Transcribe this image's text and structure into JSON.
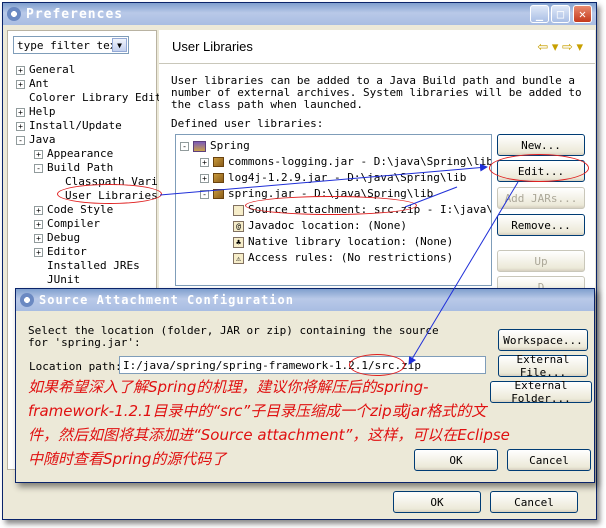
{
  "window": {
    "title": "Preferences"
  },
  "left": {
    "filter_text": "type filter tex",
    "tree": [
      {
        "label": "General",
        "toggle": "+",
        "indent": 0
      },
      {
        "label": "Ant",
        "toggle": "+",
        "indent": 0
      },
      {
        "label": "Colorer Library Edit",
        "toggle": "",
        "indent": 0
      },
      {
        "label": "Help",
        "toggle": "+",
        "indent": 0
      },
      {
        "label": "Install/Update",
        "toggle": "+",
        "indent": 0
      },
      {
        "label": "Java",
        "toggle": "-",
        "indent": 0
      },
      {
        "label": "Appearance",
        "toggle": "+",
        "indent": 1
      },
      {
        "label": "Build Path",
        "toggle": "-",
        "indent": 1
      },
      {
        "label": "Classpath Vari",
        "toggle": "",
        "indent": 2
      },
      {
        "label": "User Libraries",
        "toggle": "",
        "indent": 2
      },
      {
        "label": "Code Style",
        "toggle": "+",
        "indent": 1
      },
      {
        "label": "Compiler",
        "toggle": "+",
        "indent": 1
      },
      {
        "label": "Debug",
        "toggle": "+",
        "indent": 1
      },
      {
        "label": "Editor",
        "toggle": "+",
        "indent": 1
      },
      {
        "label": "Installed JREs",
        "toggle": "",
        "indent": 1
      },
      {
        "label": "JUnit",
        "toggle": "",
        "indent": 1
      }
    ]
  },
  "right": {
    "title": "User Libraries",
    "nav": "⇦ ▾ ⇨ ▾",
    "description": "User libraries can be added to a Java Build path and bundle a number of external archives. System libraries will be added to the class path when launched.",
    "defined_label": "Defined user libraries:",
    "libraries": [
      {
        "text": "Spring",
        "indent": 0,
        "toggle": "-",
        "icon": "library-icon"
      },
      {
        "text": "commons-logging.jar - D:\\java\\Spring\\lib",
        "indent": 1,
        "toggle": "+",
        "icon": "jar-icon"
      },
      {
        "text": "log4j-1.2.9.jar - D:\\java\\Spring\\lib",
        "indent": 1,
        "toggle": "+",
        "icon": "jar-icon"
      },
      {
        "text": "spring.jar - D:\\java\\Spring\\lib",
        "indent": 1,
        "toggle": "-",
        "icon": "jar-icon"
      },
      {
        "text": "Source attachment: src.zip - I:\\java\\spr",
        "indent": 2,
        "toggle": "",
        "icon": "source-icon"
      },
      {
        "text": "Javadoc location: (None)",
        "indent": 2,
        "toggle": "",
        "icon": "javadoc-icon"
      },
      {
        "text": "Native library location: (None)",
        "indent": 2,
        "toggle": "",
        "icon": "native-icon"
      },
      {
        "text": "Access rules: (No restrictions)",
        "indent": 2,
        "toggle": "",
        "icon": "access-icon"
      }
    ],
    "buttons": {
      "new": "New...",
      "edit": "Edit...",
      "add_jars": "Add JARs...",
      "remove": "Remove...",
      "up": "Up",
      "down": "D"
    }
  },
  "dialog": {
    "title": "Source Attachment Configuration",
    "text": "Select the location (folder, JAR or zip) containing the source for 'spring.jar':",
    "path_label": "Location path:",
    "path_value": "I:/java/spring/spring-framework-1.2.1/src.zip",
    "buttons": {
      "workspace": "Workspace...",
      "external_file": "External File...",
      "external_folder": "External Folder...",
      "ok": "OK",
      "cancel": "Cancel"
    },
    "note": "如果希望深入了解Spring的机理，建议你将解压后的spring-framework-1.2.1目录中的“src”子目录压缩成一个zip或jar格式的文件，然后如图将其添加进“Source attachment”，这样，可以在Eclipse中随时查看Spring的源代码了"
  },
  "footer": {
    "ok": "OK",
    "cancel": "Cancel"
  },
  "colors": {
    "annotation": "#e01010",
    "arrow": "#1f2fd8"
  }
}
